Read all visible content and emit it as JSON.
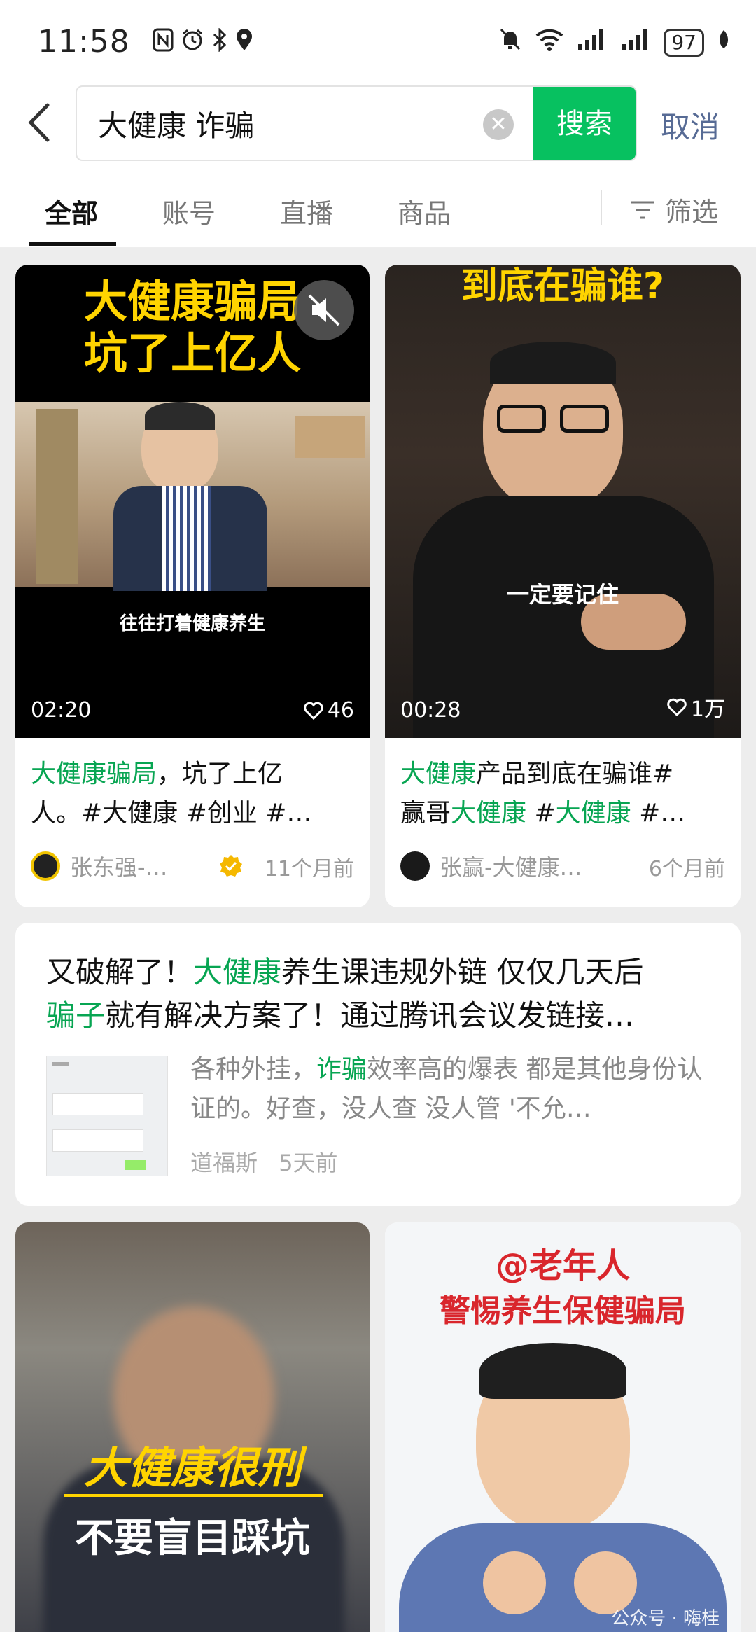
{
  "status_bar": {
    "time": "11:58",
    "battery": "97"
  },
  "search": {
    "query": "大健康 诈骗",
    "search_label": "搜索",
    "cancel_label": "取消"
  },
  "tabs": [
    {
      "label": "全部",
      "active": true
    },
    {
      "label": "账号",
      "active": false
    },
    {
      "label": "直播",
      "active": false
    },
    {
      "label": "商品",
      "active": false
    }
  ],
  "filter_label": "筛选",
  "videos": [
    {
      "thumb_title_line1": "大健康骗局",
      "thumb_title_line2": "坑了上亿人",
      "thumb_caption": "往往打着健康养生",
      "duration": "02:20",
      "likes": "46",
      "title_hl": "大健康骗局",
      "title_rest1": "，坑了上亿",
      "title_line2": "人。#大健康 #创业 #…",
      "author": "张东强-…",
      "time": "11个月前"
    },
    {
      "thumb_title": "到底在骗谁?",
      "thumb_caption": "一定要记住",
      "duration": "00:28",
      "likes": "1万",
      "title_hl": "大健康",
      "title_rest1": "产品到底在骗谁#",
      "title_line2_a": "赢哥",
      "title_line2_hl1": "大健康",
      "title_line2_b": " #",
      "title_line2_hl2": "大健康",
      "title_line2_c": " #…",
      "author": "张赢-大健康…",
      "time": "6个月前"
    }
  ],
  "article": {
    "title_a": "又破解了！",
    "title_hl1": "大健康",
    "title_b": "养生课违规外链 仅仅几天后",
    "title_hl2": "骗子",
    "title_c": "就有解决方案了！通过腾讯会议发链接…",
    "snippet_a": "各种外挂，",
    "snippet_hl": "诈骗",
    "snippet_b": "效率高的爆表 都是其他身份认证的。好查，没人查 没人管 '不允…",
    "author": "道福斯",
    "time": "5天前"
  },
  "bottom_videos": [
    {
      "caption1": "大健康很刑",
      "caption2": "不要盲目踩坑"
    },
    {
      "caption1": "@老年人",
      "caption2": "警惕养生保健骗局",
      "watermark": "公众号 · 嗨桂"
    }
  ]
}
